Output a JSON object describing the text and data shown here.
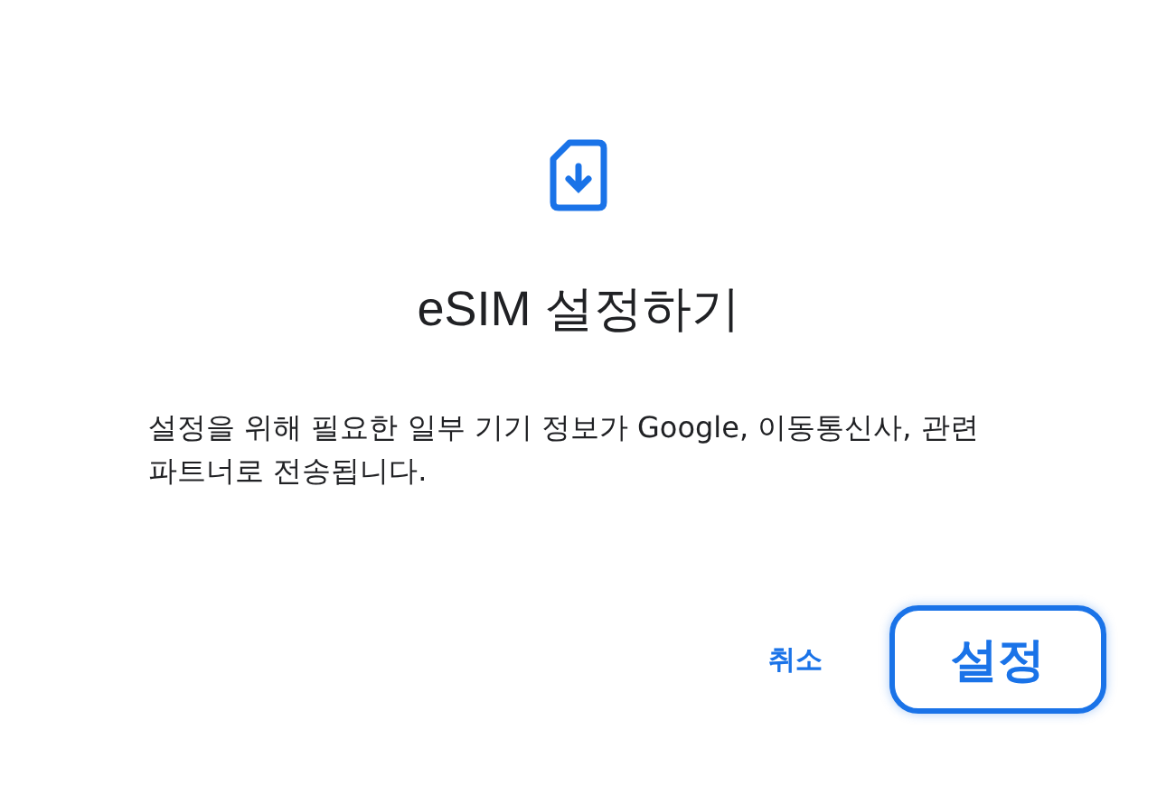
{
  "dialog": {
    "title": "eSIM 설정하기",
    "message": "설정을 위해 필요한 일부 기기 정보가 Google, 이동통신사, 관련 파트너로 전송됩니다.",
    "buttons": [
      {
        "label": "취소",
        "focused": false
      },
      {
        "label": "설정",
        "focused": true
      }
    ]
  }
}
